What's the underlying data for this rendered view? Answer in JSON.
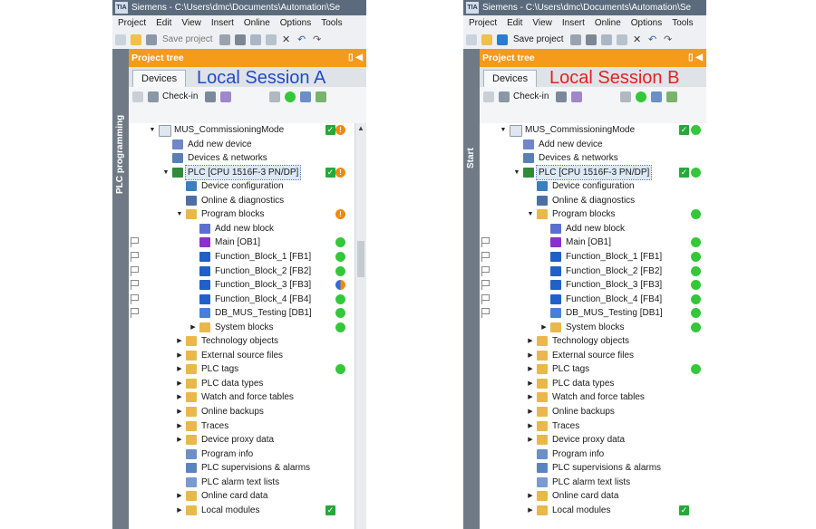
{
  "title": "Siemens  -  C:\\Users\\dmc\\Documents\\Automation\\Se",
  "app_logo": "TIA",
  "menu": [
    "Project",
    "Edit",
    "View",
    "Insert",
    "Online",
    "Options",
    "Tools"
  ],
  "toolbar": {
    "save_label": "Save project"
  },
  "project_tree": {
    "title": "Project tree",
    "devices_tab": "Devices",
    "checkin_label": "Check-in"
  },
  "panel_a": {
    "session": "Local Session A",
    "side_label": "PLC programming"
  },
  "panel_b": {
    "session": "Local Session B",
    "side_label": "Start"
  },
  "colors": {
    "accent": "#f59a1b",
    "session_a": "#1e4bc9",
    "session_b": "#e0241f",
    "status_ok": "#34c73a",
    "status_warn": "#f08a0c"
  },
  "tree": [
    {
      "label": "MUS_CommissioningMode",
      "level": 0,
      "expand": "open",
      "icon": "project-icon"
    },
    {
      "label": "Add new device",
      "level": 1,
      "expand": "none",
      "icon": "add-device-icon"
    },
    {
      "label": "Devices & networks",
      "level": 1,
      "expand": "none",
      "icon": "network-icon"
    },
    {
      "label": "PLC [CPU 1516F-3 PN/DP]",
      "level": 1,
      "expand": "open",
      "icon": "plc-icon",
      "selected": true
    },
    {
      "label": "Device configuration",
      "level": 2,
      "expand": "none",
      "icon": "device-config-icon"
    },
    {
      "label": "Online & diagnostics",
      "level": 2,
      "expand": "none",
      "icon": "diagnostics-icon"
    },
    {
      "label": "Program blocks",
      "level": 2,
      "expand": "open",
      "icon": "folder-icon"
    },
    {
      "label": "Add new block",
      "level": 3,
      "expand": "none",
      "icon": "add-block-icon"
    },
    {
      "label": "Main [OB1]",
      "level": 3,
      "expand": "none",
      "icon": "ob-block-icon",
      "flag": true
    },
    {
      "label": "Function_Block_1 [FB1]",
      "level": 3,
      "expand": "none",
      "icon": "fb-block-icon",
      "flag": true
    },
    {
      "label": "Function_Block_2 [FB2]",
      "level": 3,
      "expand": "none",
      "icon": "fb-block-icon",
      "flag": true
    },
    {
      "label": "Function_Block_3 [FB3]",
      "level": 3,
      "expand": "none",
      "icon": "fb-block-icon",
      "flag": true
    },
    {
      "label": "Function_Block_4 [FB4]",
      "level": 3,
      "expand": "none",
      "icon": "fb-block-icon",
      "flag": true
    },
    {
      "label": "DB_MUS_Testing [DB1]",
      "level": 3,
      "expand": "none",
      "icon": "db-block-icon",
      "flag": true
    },
    {
      "label": "System blocks",
      "level": 3,
      "expand": "closed",
      "icon": "folder-icon"
    },
    {
      "label": "Technology objects",
      "level": 2,
      "expand": "closed",
      "icon": "folder-icon"
    },
    {
      "label": "External source files",
      "level": 2,
      "expand": "closed",
      "icon": "folder-icon"
    },
    {
      "label": "PLC tags",
      "level": 2,
      "expand": "closed",
      "icon": "folder-icon"
    },
    {
      "label": "PLC data types",
      "level": 2,
      "expand": "closed",
      "icon": "folder-icon"
    },
    {
      "label": "Watch and force tables",
      "level": 2,
      "expand": "closed",
      "icon": "folder-icon"
    },
    {
      "label": "Online backups",
      "level": 2,
      "expand": "closed",
      "icon": "folder-icon"
    },
    {
      "label": "Traces",
      "level": 2,
      "expand": "closed",
      "icon": "folder-icon"
    },
    {
      "label": "Device proxy data",
      "level": 2,
      "expand": "closed",
      "icon": "folder-icon"
    },
    {
      "label": "Program info",
      "level": 2,
      "expand": "none",
      "icon": "info-icon"
    },
    {
      "label": "PLC supervisions & alarms",
      "level": 2,
      "expand": "none",
      "icon": "alarm-icon"
    },
    {
      "label": "PLC alarm text lists",
      "level": 2,
      "expand": "none",
      "icon": "text-list-icon"
    },
    {
      "label": "Online card data",
      "level": 2,
      "expand": "closed",
      "icon": "folder-icon"
    },
    {
      "label": "Local modules",
      "level": 2,
      "expand": "closed",
      "icon": "folder-icon"
    }
  ],
  "status_a": [
    [
      "check",
      "orange"
    ],
    [],
    [],
    [
      "check",
      "orange"
    ],
    [],
    [],
    [
      "orange"
    ],
    [],
    [
      "green"
    ],
    [
      "green"
    ],
    [
      "green"
    ],
    [
      "mixed"
    ],
    [
      "green"
    ],
    [
      "green"
    ],
    [
      "green"
    ],
    [],
    [],
    [
      "green"
    ],
    [],
    [],
    [],
    [],
    [],
    [],
    [],
    [],
    [],
    [
      "check"
    ]
  ],
  "status_b": [
    [
      "check",
      "green"
    ],
    [],
    [],
    [
      "check",
      "green"
    ],
    [],
    [],
    [
      "green"
    ],
    [],
    [
      "green"
    ],
    [
      "green"
    ],
    [
      "green"
    ],
    [
      "green"
    ],
    [
      "green"
    ],
    [
      "green"
    ],
    [
      "green"
    ],
    [],
    [],
    [
      "green"
    ],
    [],
    [],
    [],
    [],
    [],
    [],
    [],
    [],
    [],
    [
      "check"
    ]
  ]
}
